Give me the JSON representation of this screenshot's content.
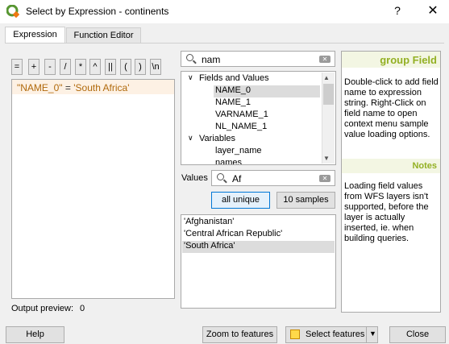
{
  "window": {
    "title": "Select by Expression - continents",
    "help_glyph": "?",
    "close_glyph": "✕",
    "logo_icon": "qgis-logo-icon"
  },
  "tabs": [
    {
      "label": "Expression",
      "active": true
    },
    {
      "label": "Function Editor",
      "active": false
    }
  ],
  "operators": [
    "=",
    "+",
    "-",
    "/",
    "*",
    "^",
    "||",
    "(",
    ")",
    "\\n"
  ],
  "expression": {
    "field": "\"NAME_0\"",
    "operator": " = ",
    "value": "'South Africa'"
  },
  "preview": {
    "label": "Output preview:",
    "value": "0"
  },
  "search": {
    "value": "nam",
    "icon": "search-icon"
  },
  "tree": {
    "groups": [
      {
        "label": "Fields and Values",
        "arrow": "∨",
        "items": [
          "NAME_0",
          "NAME_1",
          "VARNAME_1",
          "NL_NAME_1"
        ]
      },
      {
        "label": "Variables",
        "arrow": "∨",
        "items": [
          "layer_name",
          "names"
        ]
      }
    ],
    "selected": "NAME_0"
  },
  "values": {
    "label": "Values",
    "search_value": "Af",
    "all_unique_label": "all unique",
    "samples_label": "10 samples",
    "items": [
      "'Afghanistan'",
      "'Central African Republic'",
      "'South Africa'"
    ],
    "selected_index": 2
  },
  "help": {
    "heading": "group Field",
    "text": "Double-click to add field name to expression string. Right-Click on field name to open context menu sample value loading options.",
    "notes_heading": "Notes",
    "notes_text": "Loading field values from WFS layers isn't supported, before the layer is actually inserted, ie. when building queries.",
    "accent_color": "#93b023"
  },
  "footer": {
    "help_label": "Help",
    "zoom_label": "Zoom to features",
    "select_label": "Select features",
    "close_label": "Close"
  }
}
